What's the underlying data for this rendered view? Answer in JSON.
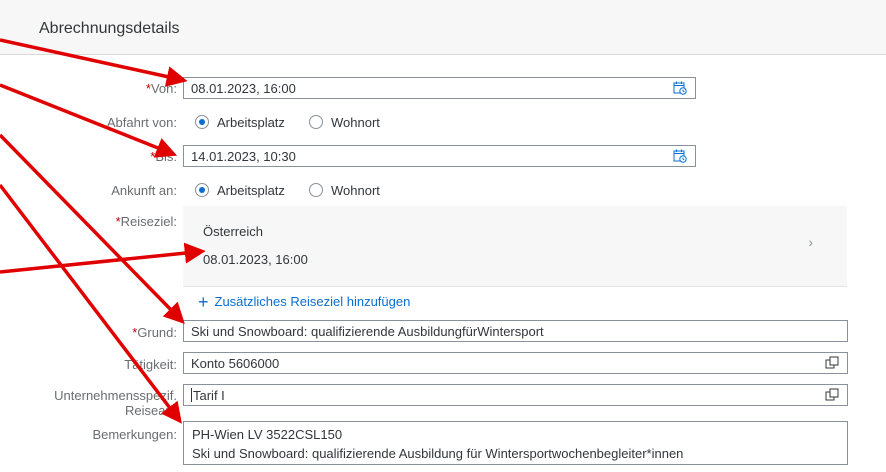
{
  "header": {
    "title": "Abrechnungsdetails"
  },
  "form": {
    "von": {
      "required": "*",
      "label": "Von:",
      "value": "08.01.2023, 16:00",
      "icon": "calendar-clock-icon"
    },
    "abfahrt": {
      "label": "Abfahrt von:",
      "options": [
        "Arbeitsplatz",
        "Wohnort"
      ],
      "selected": "Arbeitsplatz"
    },
    "bis": {
      "required": "*",
      "label": "Bis:",
      "value": "14.01.2023, 10:30",
      "icon": "calendar-clock-icon"
    },
    "ankunft": {
      "label": "Ankunft an:",
      "options": [
        "Arbeitsplatz",
        "Wohnort"
      ],
      "selected": "Arbeitsplatz"
    },
    "reiseziel": {
      "required": "*",
      "label": "Reiseziel:",
      "country": "Österreich",
      "date": "08.01.2023, 16:00",
      "chevron": "chevron-right-icon",
      "add_label": "Zusätzliches Reiseziel hinzufügen"
    },
    "grund": {
      "required": "*",
      "label": "Grund:",
      "value": "Ski und Snowboard: qualifizierende AusbildungfürWintersport"
    },
    "taetigkeit": {
      "label": "Tätigkeit:",
      "value": "Konto 5606000",
      "icon": "value-help-icon"
    },
    "reiseart": {
      "label_line1": "Unternehmensspezif.",
      "label_line2": "Reiseart:",
      "value": "Tarif I",
      "icon": "value-help-icon"
    },
    "bemerkungen": {
      "label": "Bemerkungen:",
      "line1": "PH-Wien LV 3522CSL150",
      "line2": "Ski und Snowboard: qualifizierende Ausbildung für Wintersportwochenbegleiter*innen"
    }
  },
  "colors": {
    "annotation_arrow": "#e00000",
    "accent": "#0a6ed1",
    "required": "#bb0000"
  }
}
